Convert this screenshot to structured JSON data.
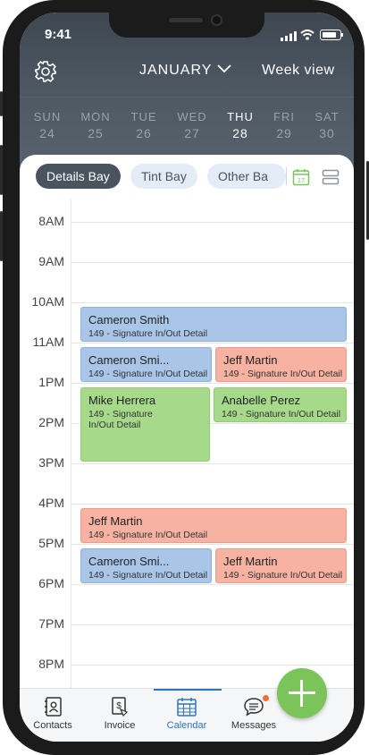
{
  "status": {
    "time": "9:41"
  },
  "header": {
    "month": "JANUARY",
    "view_label": "Week view"
  },
  "days": [
    {
      "name": "SUN",
      "num": "24"
    },
    {
      "name": "MON",
      "num": "25"
    },
    {
      "name": "TUE",
      "num": "26"
    },
    {
      "name": "WED",
      "num": "27"
    },
    {
      "name": "THU",
      "num": "28"
    },
    {
      "name": "FRI",
      "num": "29"
    },
    {
      "name": "SAT",
      "num": "30"
    }
  ],
  "bays": [
    "Details Bay",
    "Tint Bay",
    "Other Ba"
  ],
  "calendar_icon_day": "17",
  "hours": [
    "8AM",
    "9AM",
    "10AM",
    "11AM",
    "1PM",
    "2PM",
    "3PM",
    "4PM",
    "5PM",
    "6PM",
    "7PM",
    "8PM"
  ],
  "events": [
    {
      "name": "Cameron Smith",
      "service": "149 - Signature In/Out Detail",
      "color": "blue"
    },
    {
      "name": "Cameron Smi...",
      "service": "149 - Signature In/Out Detail",
      "color": "blue"
    },
    {
      "name": "Jeff Martin",
      "service": "149 - Signature In/Out Detail",
      "color": "salmon"
    },
    {
      "name": "Mike Herrera",
      "service": "149 - Signature In/Out Detail",
      "color": "green"
    },
    {
      "name": "Anabelle Perez",
      "service": "149 - Signature In/Out Detail",
      "color": "green"
    },
    {
      "name": "Jeff Martin",
      "service": "149 - Signature In/Out Detail",
      "color": "salmon"
    },
    {
      "name": "Cameron Smi...",
      "service": "149 - Signature In/Out Detail",
      "color": "blue"
    },
    {
      "name": "Jeff Martin",
      "service": "149 - Signature In/Out Detail",
      "color": "salmon"
    }
  ],
  "tabs": [
    "Contacts",
    "Invoice",
    "Calendar",
    "Messages"
  ],
  "colors": {
    "blue": "#a9c6e8",
    "salmon": "#f7b2a2",
    "green": "#a6d98a",
    "accent": "#2f73c0",
    "fab": "#7ac45a"
  }
}
